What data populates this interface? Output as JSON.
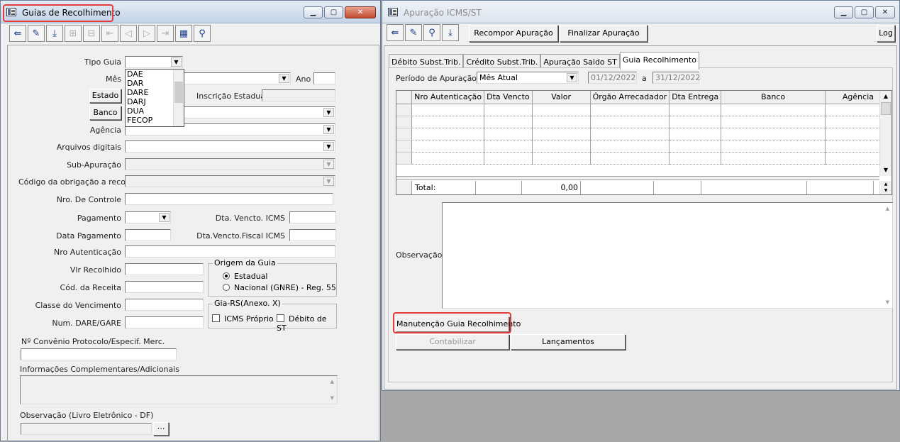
{
  "left_window": {
    "title": "Guias de Recolhimento",
    "form": {
      "tipo_guia_label": "Tipo Guia",
      "tipo_guia_value": "",
      "tipo_guia_options": [
        "DAE",
        "DAR",
        "DARE",
        "DARJ",
        "DUA",
        "FECOP"
      ],
      "mes_label": "Mês",
      "ano_label": "Ano",
      "estado_button": "Estado",
      "inscricao_estadual_label": "Inscrição Estadual",
      "banco_button": "Banco",
      "agencia_label": "Agência",
      "arquivos_digitais_label": "Arquivos digitais",
      "sub_apuracao_label": "Sub-Apuração",
      "codigo_obrigacao_label": "Código da obrigação a recolher",
      "nro_controle_label": "Nro. De Controle",
      "pagamento_label": "Pagamento",
      "dta_vencto_icms_label": "Dta. Vencto. ICMS",
      "data_pagamento_label": "Data Pagamento",
      "dta_vencto_fiscal_icms_label": "Dta.Vencto.Fiscal ICMS",
      "nro_autenticacao_label": "Nro Autenticação",
      "vlr_recolhido_label": "Vlr Recolhido",
      "cod_receita_label": "Cód. da Receita",
      "classe_vencimento_label": "Classe do Vencimento",
      "num_dare_gare_label": "Num. DARE/GARE",
      "origem_guia_title": "Origem da Guia",
      "origem_estadual": "Estadual",
      "origem_nacional": "Nacional (GNRE) - Reg. 55",
      "gia_rs_title": "Gia-RS(Anexo. X)",
      "icms_proprio": "ICMS Próprio",
      "debito_st": "Débito de ST",
      "convenio_label": "Nº Convênio Protocolo/Especif. Merc.",
      "info_complementares_label": "Informações Complementares/Adicionais",
      "observacao_livro_label": "Observação (Livro Eletrônico - DF)"
    }
  },
  "right_window": {
    "title": "Apuração ICMS/ST",
    "toolbar": {
      "recompor_label": "Recompor Apuração",
      "finalizar_label": "Finalizar Apuração",
      "log_label": "Log"
    },
    "tabs": [
      "Débito Subst.Trib.",
      "Crédito Subst.Trib.",
      "Apuração Saldo ST",
      "Guia Recolhimento"
    ],
    "periodo_label": "Período de  Apuração",
    "periodo_value": "Mês Atual",
    "date_from": "01/12/2022",
    "date_sep": "a",
    "date_to": "31/12/2022",
    "grid": {
      "columns": [
        "Nro Autenticação",
        "Dta Vencto",
        "Valor",
        "Órgão Arrecadador",
        "Dta Entrega",
        "Banco",
        "Agência"
      ],
      "total_label": "Total:",
      "total_value": "0,00"
    },
    "observacao_label": "Observação",
    "manutencao_button": "Manutenção Guia Recolhimento",
    "contabilizar_button": "Contabilizar",
    "lancamentos_button": "Lançamentos"
  }
}
